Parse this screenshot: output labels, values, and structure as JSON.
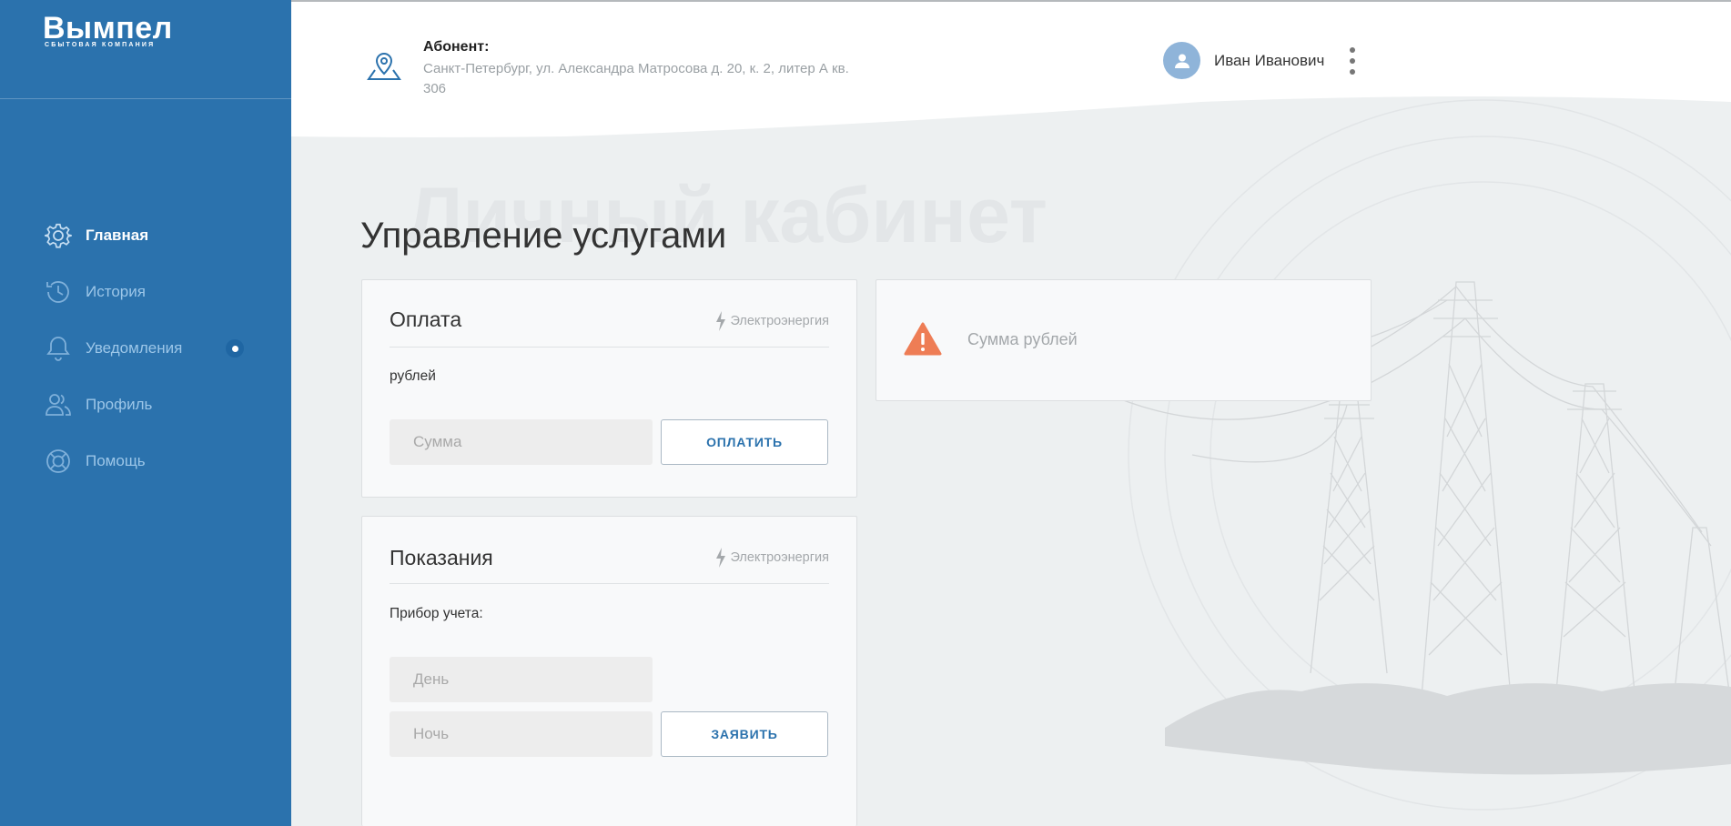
{
  "app": {
    "logo_main": "Вымпел",
    "logo_sub": "СБЫТОВАЯ КОМПАНИЯ"
  },
  "sidebar": {
    "items": [
      {
        "label": "Главная",
        "icon": "gear-icon",
        "active": true
      },
      {
        "label": "История",
        "icon": "history-icon",
        "active": false
      },
      {
        "label": "Уведомления",
        "icon": "bell-icon",
        "active": false,
        "badge": true
      },
      {
        "label": "Профиль",
        "icon": "users-icon",
        "active": false
      },
      {
        "label": "Помощь",
        "icon": "lifebuoy-icon",
        "active": false
      }
    ]
  },
  "header": {
    "subscriber_title": "Абонент:",
    "subscriber_address": "Санкт-Петербург, ул. Александра Матросова д. 20, к. 2, литер А кв. 306",
    "user_name": "Иван Иванович"
  },
  "main": {
    "watermark": "Личный кабинет",
    "page_title": "Управление услугами",
    "payment_card": {
      "title": "Оплата",
      "tag": "Электроэнергия",
      "amount_text": "рублей",
      "sum_placeholder": "Сумма",
      "button_label": "ОПЛАТИТЬ"
    },
    "readings_card": {
      "title": "Показания",
      "tag": "Электроэнергия",
      "meter_label": "Прибор учета:",
      "day_placeholder": "День",
      "night_placeholder": "Ночь",
      "button_label": "ЗАЯВИТЬ"
    },
    "alert_card": {
      "icon": "warning-icon",
      "text": "Сумма рублей"
    }
  },
  "colors": {
    "sidebar_bg": "#2b72ad",
    "accent": "#2b72ad",
    "warning": "#ee7d55",
    "page_bg": "#edf0f1"
  }
}
